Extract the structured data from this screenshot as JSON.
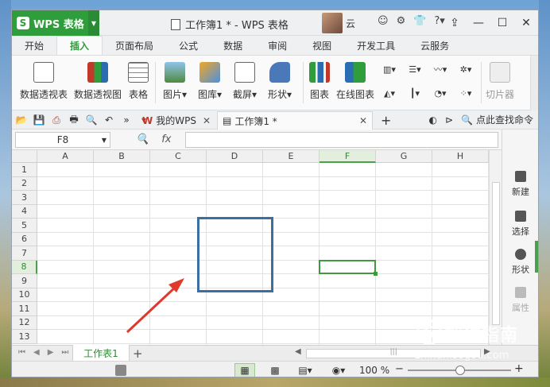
{
  "app": {
    "name": "WPS 表格",
    "doc_title": "工作簿1 * - WPS 表格",
    "user": "云"
  },
  "menu": {
    "tabs": [
      "开始",
      "插入",
      "页面布局",
      "公式",
      "数据",
      "审阅",
      "视图",
      "开发工具",
      "云服务"
    ],
    "active": "插入"
  },
  "ribbon": {
    "pivot_table": "数据透视表",
    "pivot_chart": "数据透视图",
    "table": "表格",
    "picture": "图片",
    "gallery": "图库",
    "screenshot": "截屏",
    "shape": "形状",
    "chart": "图表",
    "online_chart": "在线图表",
    "slicer": "切片器"
  },
  "doc_tabs": {
    "home": "我的WPS",
    "workbook": "工作簿1 *",
    "find": "点此查找命令"
  },
  "formula_bar": {
    "name_box": "F8",
    "fx": "fx"
  },
  "grid": {
    "columns": [
      "A",
      "B",
      "C",
      "D",
      "E",
      "F",
      "G",
      "H"
    ],
    "rows": [
      "1",
      "2",
      "3",
      "4",
      "5",
      "6",
      "7",
      "8",
      "9",
      "10",
      "11",
      "12",
      "13"
    ],
    "selected_col": "F",
    "selected_row": "8"
  },
  "side_panel": {
    "new": "新建",
    "select": "选择",
    "shape": "形状",
    "property": "属性"
  },
  "sheet": {
    "tab_name": "工作表1",
    "add": "+"
  },
  "status": {
    "zoom": "100 %"
  },
  "watermark": {
    "name": "搜狗指南",
    "url": "zhinan.sogou.com"
  },
  "colors": {
    "accent": "#2f9d3c",
    "highlight_box": "#3a6fa3",
    "arrow": "#e0392b"
  }
}
